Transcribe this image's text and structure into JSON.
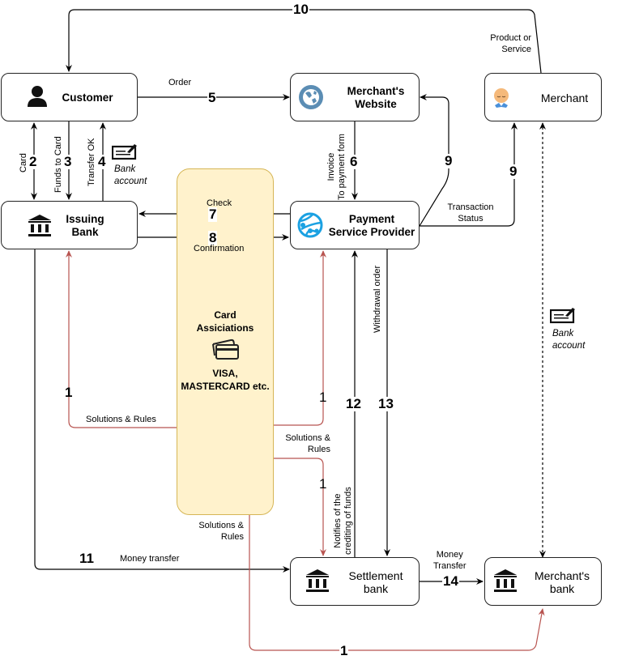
{
  "nodes": {
    "customer": {
      "label": "Customer",
      "icon": "person-icon"
    },
    "merchants_website": {
      "label_line1": "Merchant's",
      "label_line2": "Website",
      "icon": "globe-icon"
    },
    "merchant": {
      "label": "Merchant",
      "icon": "merchant-face-icon"
    },
    "issuing_bank": {
      "label_line1": "Issuing",
      "label_line2": "Bank",
      "icon": "bank-icon"
    },
    "psp": {
      "label_line1": "Payment",
      "label_line2": "Service Provider",
      "icon": "network-globe-icon"
    },
    "settlement_bank": {
      "label_line1": "Settlement",
      "label_line2": "bank",
      "icon": "bank-icon"
    },
    "merchants_bank": {
      "label_line1": "Merchant's",
      "label_line2": "bank",
      "icon": "bank-icon"
    },
    "card_associations": {
      "title_line1": "Card",
      "title_line2": "Assiciations",
      "brands_line1": "VISA,",
      "brands_line2": "MASTERCARD etc.",
      "icon": "credit-cards-icon"
    }
  },
  "annotations": {
    "bank_account_left": {
      "line1": "Bank",
      "line2": "account",
      "icon": "check-icon"
    },
    "bank_account_right": {
      "line1": "Bank",
      "line2": "account",
      "icon": "check-icon"
    }
  },
  "edges": {
    "e10": {
      "num": "10",
      "label_line1": "Product or",
      "label_line2": "Service"
    },
    "e5": {
      "num": "5",
      "label": "Order"
    },
    "e2": {
      "num": "2",
      "label": "Card"
    },
    "e3": {
      "num": "3",
      "label": "Funds to Card"
    },
    "e4": {
      "num": "4",
      "label": "Transfer OK"
    },
    "e6": {
      "num": "6",
      "label_line1": "Invoice",
      "label_line2": "To payment form"
    },
    "e7": {
      "num": "7",
      "label": "Check"
    },
    "e8": {
      "num": "8",
      "label": "Confirmation"
    },
    "e9a": {
      "num": "9"
    },
    "e9b": {
      "num": "9",
      "label_line1": "Transaction",
      "label_line2": "Status"
    },
    "e1_issuing": {
      "num": "1",
      "label": "Solutions & Rules"
    },
    "e1_psp": {
      "num": "1",
      "label_line1": "Solutions &",
      "label_line2": "Rules"
    },
    "e1_settlement": {
      "num": "1"
    },
    "e1_merchants_bank": {
      "num": "1",
      "label_line1": "Solutions &",
      "label_line2": "Rules"
    },
    "e12": {
      "num": "12",
      "label_line1": "Notifies of the",
      "label_line2": "crediting of funds"
    },
    "e13": {
      "num": "13",
      "label": "Withdrawal order"
    },
    "e11": {
      "num": "11",
      "label": "Money transfer"
    },
    "e14": {
      "num": "14",
      "label_line1": "Money",
      "label_line2": "Transfer"
    }
  },
  "colors": {
    "edge": "#000000",
    "rules_edge": "#b85450",
    "assoc_fill": "#fff2cc",
    "assoc_stroke": "#d6b656",
    "globe": "#5b8db4",
    "network_globe": "#1ba1e2"
  }
}
